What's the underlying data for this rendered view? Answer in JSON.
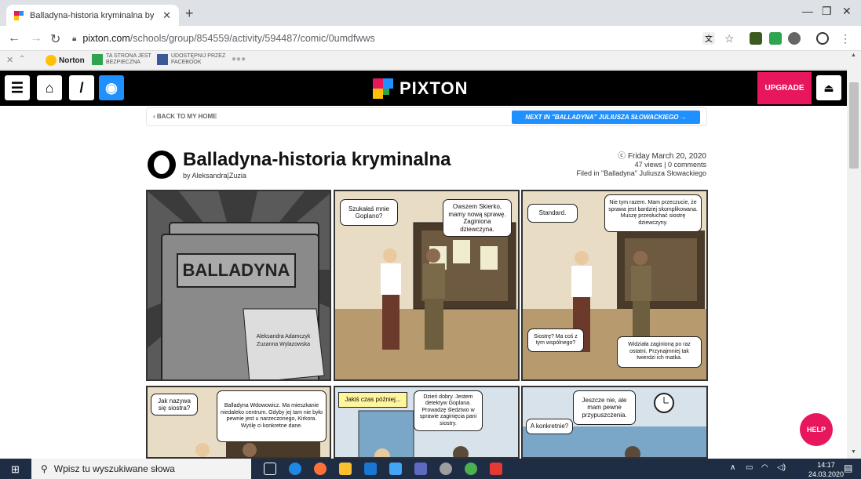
{
  "browser": {
    "tab_title": "Balladyna-historia kryminalna by",
    "url_host": "pixton.com",
    "url_path": "/schools/group/854559/activity/594487/comic/0umdfwws"
  },
  "norton": {
    "brand": "Norton",
    "safe_label": "TA STRONA JEST BEZPIECZNA",
    "share_label": "UDOSTĘPNIJ PRZEZ FACEBOOK"
  },
  "pixton": {
    "logo_text": "PIXTON",
    "upgrade_label": "UPGRADE",
    "brand_color": "#e8175d",
    "accent_color": "#1e90ff"
  },
  "comic_nav": {
    "back_label": "BACK TO MY HOME",
    "next_label": "NEXT IN \"BALLADYNA\" JULIUSZA SŁOWACKIEGO →"
  },
  "comic": {
    "title": "Balladyna-historia kryminalna",
    "author": "by Aleksandra|Zuzia",
    "date": "Friday March 20, 2020",
    "stats": "47 views | 0 comments",
    "filed": "Filed in \"Balladyna\" Juliusza Słowackiego"
  },
  "panels": {
    "p1": {
      "folder_title": "BALLADYNA",
      "names_line1": "Aleksandra Adamczyk",
      "names_line2": "Zuzanna Wylazowska"
    },
    "p2": {
      "bubble1": "Szukałaś mnie Goplano?",
      "bubble2": "Owszem Skierko, mamy nową sprawę. Zaginiona dziewczyna."
    },
    "p3": {
      "bubble1": "Standard.",
      "bubble2": "Nie tym razem. Mam przeczucie, że sprawa jest bardziej skomplikowana. Muszę przesłuchać siostrę dziewczyny.",
      "bubble3": "Siostrę? Ma coś z tym wspólnego?",
      "bubble4": "Widziała zaginioną po raz ostatni. Przynajmniej tak twierdzi ich matka."
    },
    "p4": {
      "bubble1": "Jak nazywa się siostra?",
      "bubble2": "Balladyna Wdowowicz. Ma mieszkanie niedaleko centrum. Gdyby jej tam nie było pewnie jest u narzeczonego, Kirkora. Wyślę ci konkretne dane."
    },
    "p5": {
      "caption": "Jakiś czas później...",
      "bubble1": "Dzień dobry. Jestem detektyw Goplana. Prowadzę śledztwo w sprawie zaginięcia pani siostry."
    },
    "p6": {
      "bubble1": "A konkretnie?",
      "bubble2": "Jeszcze nie, ale mam pewne przypuszczenia."
    }
  },
  "help_label": "HELP",
  "taskbar": {
    "search_placeholder": "Wpisz tu wyszukiwane słowa",
    "time": "14:17",
    "date": "24.03.2020"
  }
}
